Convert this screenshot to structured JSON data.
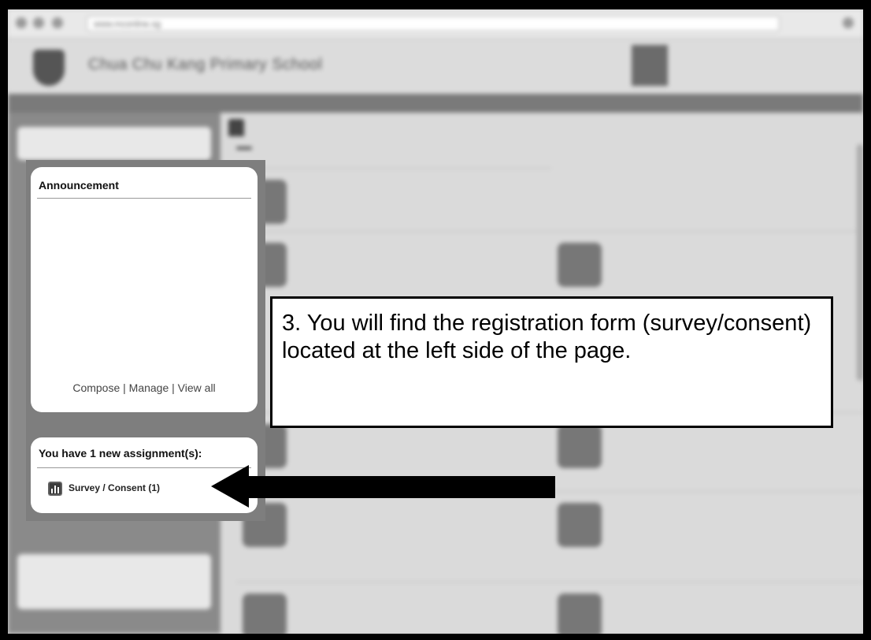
{
  "browser": {
    "url": "www.mconline.sg"
  },
  "header": {
    "school_name": "Chua Chu Kang Primary School"
  },
  "announcement": {
    "title": "Announcement",
    "links": "Compose | Manage | View all"
  },
  "assignments": {
    "title": "You have 1 new assignment(s):",
    "item_label": "Survey / Consent (1)",
    "item_icon": "bar-chart-icon"
  },
  "instruction": {
    "text": "3. You will find the registration form (survey/consent) located at the left side of the page."
  },
  "colors": {
    "frame": "#000000",
    "overlay_panel": "#7e7e7e",
    "box_background": "#ffffff"
  }
}
